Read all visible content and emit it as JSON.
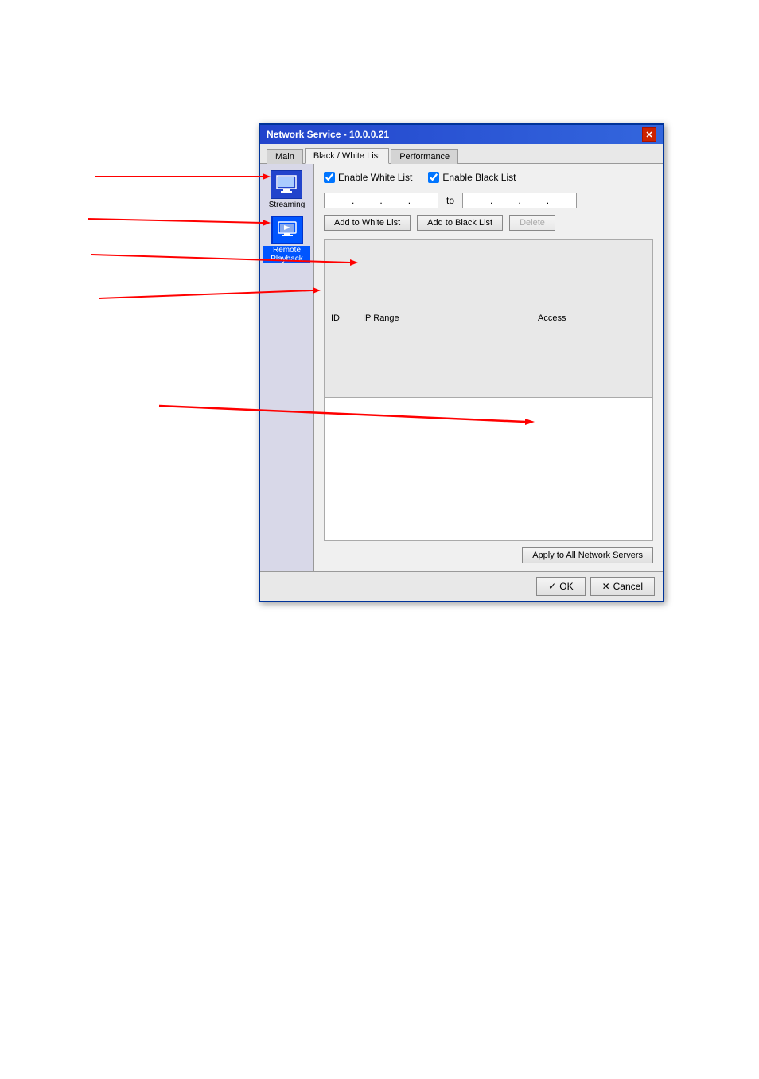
{
  "dialog": {
    "title": "Network Service - 10.0.0.21",
    "close_button": "✕",
    "tabs": [
      {
        "id": "main",
        "label": "Main",
        "active": false
      },
      {
        "id": "blackwhitelist",
        "label": "Black / White List",
        "active": true
      },
      {
        "id": "performance",
        "label": "Performance",
        "active": false
      }
    ],
    "sidebar": {
      "items": [
        {
          "id": "streaming",
          "label": "Streaming",
          "selected": false,
          "icon": "monitor-icon"
        },
        {
          "id": "remote-playback",
          "label": "Remote\nPlayback",
          "selected": true,
          "icon": "remote-icon"
        }
      ]
    },
    "content": {
      "enable_white_list_label": "Enable White List",
      "enable_black_list_label": "Enable Black List",
      "enable_white_list_checked": true,
      "enable_black_list_checked": true,
      "ip_start": {
        "o1": "",
        "o2": "",
        "o3": "",
        "o4": ""
      },
      "to_label": "to",
      "ip_end": {
        "o1": "",
        "o2": "",
        "o3": "",
        "o4": ""
      },
      "add_white_list_btn": "Add to White List",
      "add_black_list_btn": "Add to Black List",
      "delete_btn": "Delete",
      "table_headers": [
        "ID",
        "IP Range",
        "Access"
      ],
      "table_rows": [],
      "apply_btn": "Apply to All Network Servers"
    },
    "footer": {
      "ok_label": "OK",
      "cancel_label": "Cancel",
      "ok_icon": "✓",
      "cancel_icon": "✕"
    }
  }
}
